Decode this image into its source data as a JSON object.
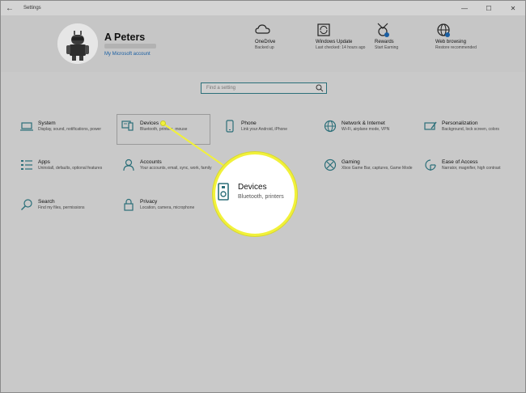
{
  "window": {
    "title": "Settings",
    "back_glyph": "←"
  },
  "controls": {
    "minimize": "—",
    "maximize": "☐",
    "close": "✕"
  },
  "account": {
    "name": "A Peters",
    "link": "My Microsoft account"
  },
  "quick_links": [
    {
      "title": "OneDrive",
      "sub": "Backed up",
      "icon": "cloud-icon"
    },
    {
      "title": "Windows Update",
      "sub": "Last checked: 14 hours ago",
      "icon": "update-icon"
    },
    {
      "title": "Rewards",
      "sub": "Start Earning",
      "icon": "rewards-icon"
    },
    {
      "title": "Web browsing",
      "sub": "Restore recommended",
      "icon": "globe-icon"
    }
  ],
  "search": {
    "placeholder": "Find a setting"
  },
  "tiles": [
    {
      "title": "System",
      "sub": "Display, sound, notifications, power",
      "icon": "laptop-icon"
    },
    {
      "title": "Devices",
      "sub": "Bluetooth, printers, mouse",
      "icon": "devices-icon"
    },
    {
      "title": "Phone",
      "sub": "Link your Android, iPhone",
      "icon": "phone-icon"
    },
    {
      "title": "Network & Internet",
      "sub": "Wi-Fi, airplane mode, VPN",
      "icon": "globe-icon"
    },
    {
      "title": "Personalization",
      "sub": "Background, lock screen, colors",
      "icon": "personalization-icon"
    },
    {
      "title": "Apps",
      "sub": "Uninstall, defaults, optional features",
      "icon": "apps-icon"
    },
    {
      "title": "Accounts",
      "sub": "Your accounts, email, sync, work, family",
      "icon": "person-icon"
    },
    {
      "title": "Gaming",
      "sub": "Xbox Game Bar, captures, Game Mode",
      "icon": "xbox-icon"
    },
    {
      "title": "Ease of Access",
      "sub": "Narrator, magnifier, high contrast",
      "icon": "ease-icon"
    },
    {
      "title": "Search",
      "sub": "Find my files, permissions",
      "icon": "search-icon"
    },
    {
      "title": "Privacy",
      "sub": "Location, camera, microphone",
      "icon": "lock-icon"
    }
  ],
  "magnifier": {
    "title": "Devices",
    "sub": "Bluetooth, printers"
  },
  "colors": {
    "accent": "#1a5fa3",
    "highlight": "#f1f13a",
    "icon_teal": "#2b6f79"
  }
}
